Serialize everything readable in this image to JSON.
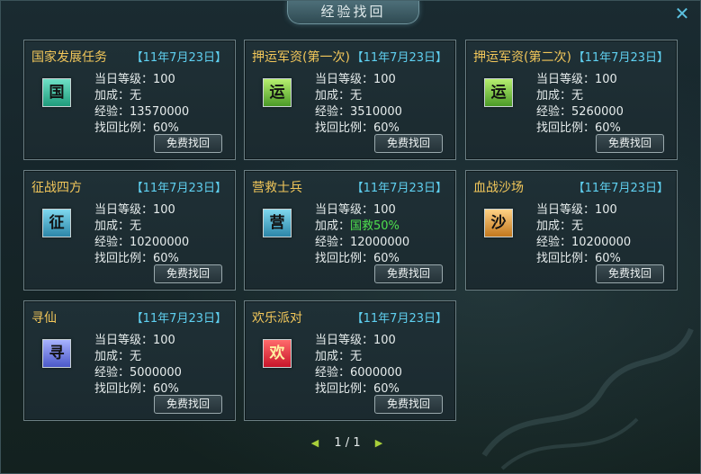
{
  "title": "经验找回",
  "close_symbol": "✕",
  "labels": {
    "level": "当日等级：",
    "bonus": "加成：",
    "exp": "经验：",
    "ratio": "找回比例：",
    "button": "免费找回"
  },
  "cards": [
    {
      "name": "国家发展任务",
      "date": "【11年7月23日】",
      "icon": "国",
      "icon_color": "teal",
      "level": "100",
      "bonus": "无",
      "bonus_highlight": false,
      "exp": "13570000",
      "ratio": "60%"
    },
    {
      "name": "押运军资(第一次)",
      "date": "【11年7月23日】",
      "icon": "运",
      "icon_color": "green",
      "level": "100",
      "bonus": "无",
      "bonus_highlight": false,
      "exp": "3510000",
      "ratio": "60%"
    },
    {
      "name": "押运军资(第二次)",
      "date": "【11年7月23日】",
      "icon": "运",
      "icon_color": "green",
      "level": "100",
      "bonus": "无",
      "bonus_highlight": false,
      "exp": "5260000",
      "ratio": "60%"
    },
    {
      "name": "征战四方",
      "date": "【11年7月23日】",
      "icon": "征",
      "icon_color": "blue",
      "level": "100",
      "bonus": "无",
      "bonus_highlight": false,
      "exp": "10200000",
      "ratio": "60%"
    },
    {
      "name": "营救士兵",
      "date": "【11年7月23日】",
      "icon": "营",
      "icon_color": "blue",
      "level": "100",
      "bonus": "国救50%",
      "bonus_highlight": true,
      "exp": "12000000",
      "ratio": "60%"
    },
    {
      "name": "血战沙场",
      "date": "【11年7月23日】",
      "icon": "沙",
      "icon_color": "orange",
      "level": "100",
      "bonus": "无",
      "bonus_highlight": false,
      "exp": "10200000",
      "ratio": "60%"
    },
    {
      "name": "寻仙",
      "date": "【11年7月23日】",
      "icon": "寻",
      "icon_color": "purple",
      "level": "100",
      "bonus": "无",
      "bonus_highlight": false,
      "exp": "5000000",
      "ratio": "60%"
    },
    {
      "name": "欢乐派对",
      "date": "【11年7月23日】",
      "icon": "欢",
      "icon_color": "red",
      "level": "100",
      "bonus": "无",
      "bonus_highlight": false,
      "exp": "6000000",
      "ratio": "60%"
    }
  ],
  "pagination": {
    "text": "1 / 1",
    "prev": "◀",
    "next": "▶"
  }
}
